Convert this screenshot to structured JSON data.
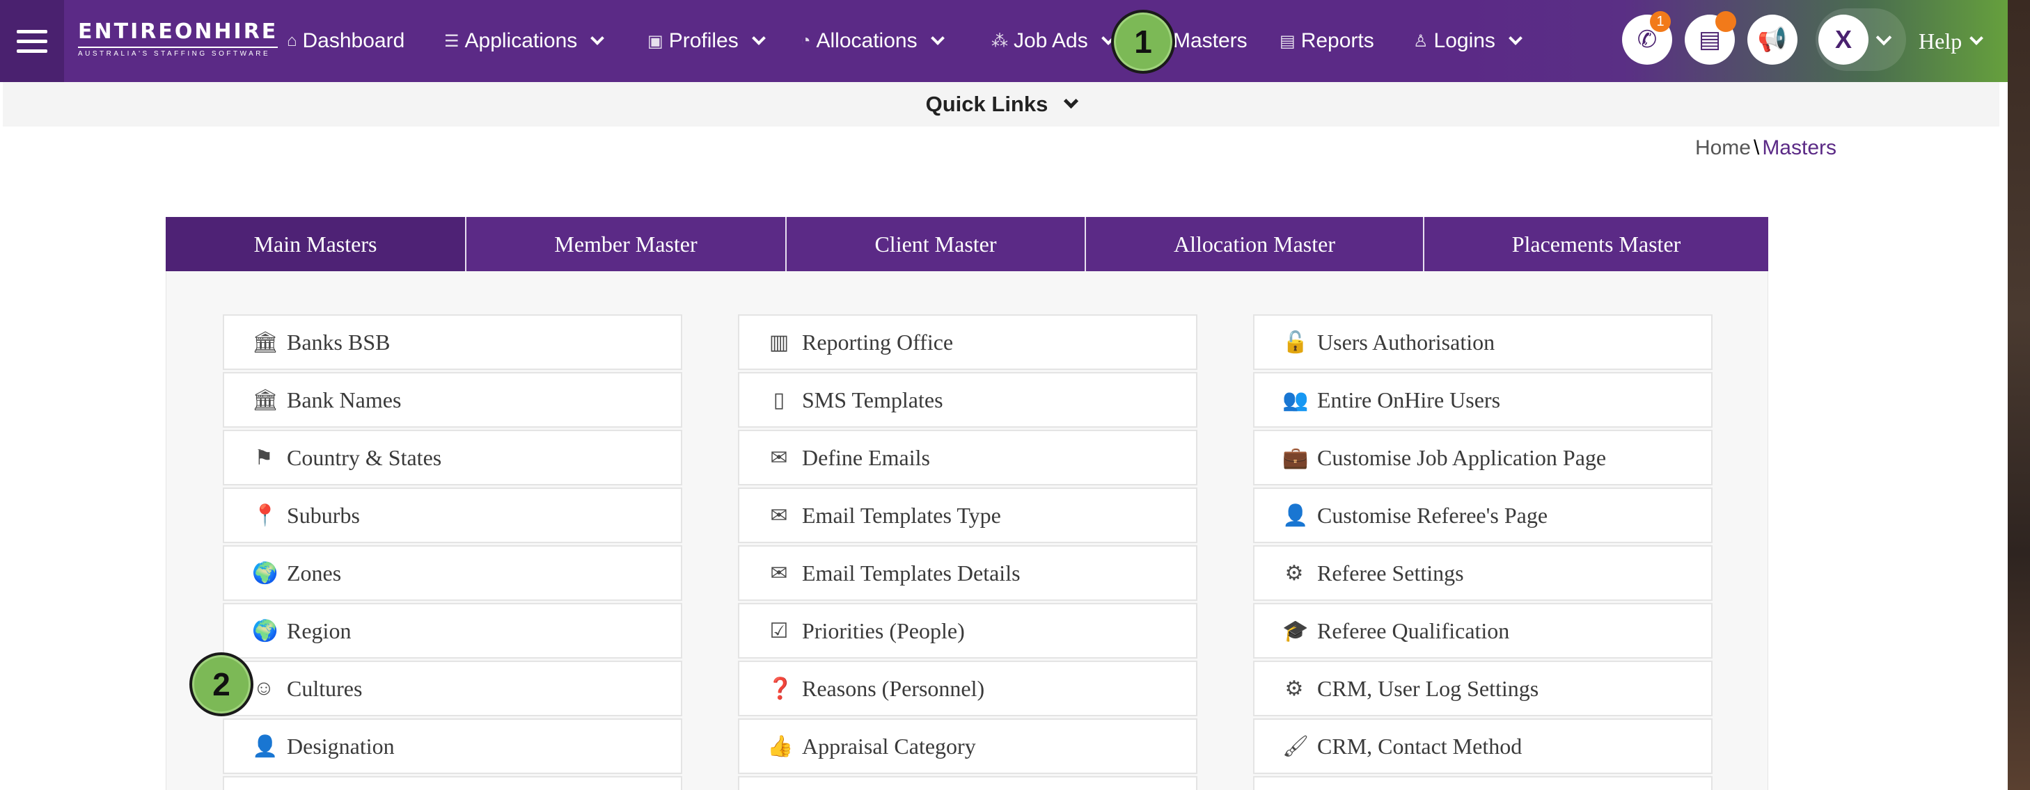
{
  "nav": {
    "logo_main": "ENTIREONHIRE",
    "logo_sub": "AUSTRALIA'S STAFFING SOFTWARE",
    "items": [
      {
        "label": "Dashboard",
        "icon": "home-icon"
      },
      {
        "label": "Applications",
        "icon": "list-icon"
      },
      {
        "label": "Profiles",
        "icon": "id-card-icon"
      },
      {
        "label": "Allocations",
        "icon": "pie-icon"
      },
      {
        "label": "Job Ads",
        "icon": "network-icon"
      },
      {
        "label": "Masters",
        "icon": "database-icon"
      },
      {
        "label": "Reports",
        "icon": "report-icon"
      },
      {
        "label": "Logins",
        "icon": "user-icon"
      }
    ],
    "phone_badge": "1",
    "user_initial": "X",
    "help_label": "Help"
  },
  "quick_links_label": "Quick Links",
  "breadcrumb": {
    "home": "Home",
    "separator": "\\",
    "current": "Masters"
  },
  "tabs": [
    {
      "label": "Main Masters",
      "active": true
    },
    {
      "label": "Member Master",
      "active": false
    },
    {
      "label": "Client Master",
      "active": false
    },
    {
      "label": "Allocation Master",
      "active": false
    },
    {
      "label": "Placements Master",
      "active": false
    }
  ],
  "columns": [
    [
      {
        "label": "Banks BSB",
        "icon": "bank-icon"
      },
      {
        "label": "Bank Names",
        "icon": "bank-icon"
      },
      {
        "label": "Country & States",
        "icon": "flag-icon"
      },
      {
        "label": "Suburbs",
        "icon": "map-marker-icon"
      },
      {
        "label": "Zones",
        "icon": "globe-icon"
      },
      {
        "label": "Region",
        "icon": "globe-icon"
      },
      {
        "label": "Cultures",
        "icon": "smile-icon"
      },
      {
        "label": "Designation",
        "icon": "user-icon"
      }
    ],
    [
      {
        "label": "Reporting Office",
        "icon": "building-icon"
      },
      {
        "label": "SMS Templates",
        "icon": "mobile-icon"
      },
      {
        "label": "Define Emails",
        "icon": "envelope-icon"
      },
      {
        "label": "Email Templates Type",
        "icon": "envelope-icon"
      },
      {
        "label": "Email Templates Details",
        "icon": "envelope-icon"
      },
      {
        "label": "Priorities (People)",
        "icon": "check-square-icon"
      },
      {
        "label": "Reasons (Personnel)",
        "icon": "question-circle-icon"
      },
      {
        "label": "Appraisal Category",
        "icon": "thumbs-up-icon"
      }
    ],
    [
      {
        "label": "Users Authorisation",
        "icon": "unlock-icon"
      },
      {
        "label": "Entire OnHire Users",
        "icon": "users-icon"
      },
      {
        "label": "Customise Job Application Page",
        "icon": "briefcase-icon"
      },
      {
        "label": "Customise Referee's Page",
        "icon": "user-plus-icon"
      },
      {
        "label": "Referee Settings",
        "icon": "cogs-icon"
      },
      {
        "label": "Referee Qualification",
        "icon": "graduation-cap-icon"
      },
      {
        "label": "CRM, User Log Settings",
        "icon": "gear-icon"
      },
      {
        "label": "CRM, Contact Method",
        "icon": "paint-brush-icon"
      }
    ]
  ],
  "markers": [
    "1",
    "2"
  ]
}
